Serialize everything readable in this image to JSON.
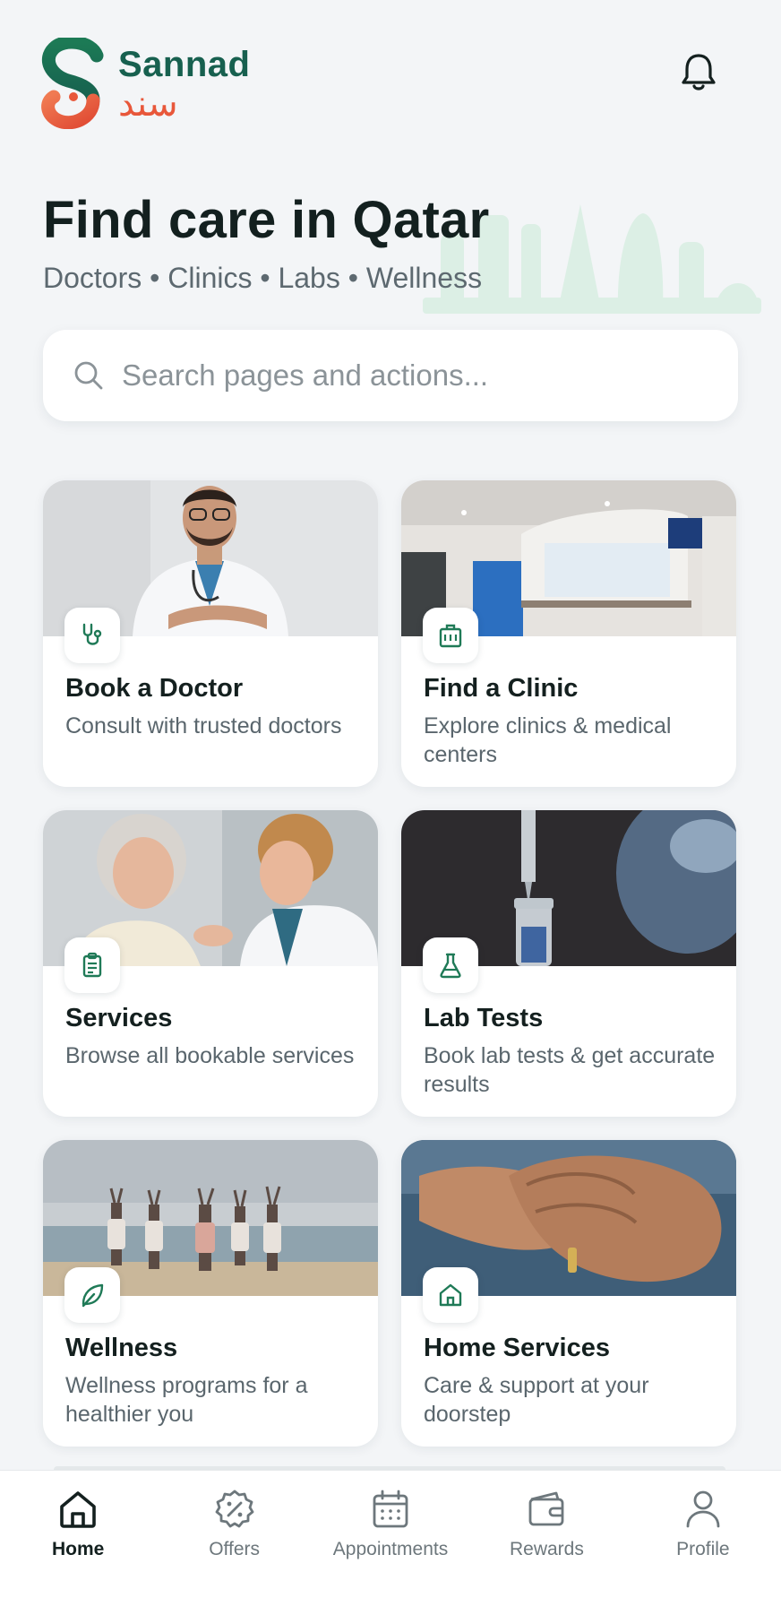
{
  "brand": {
    "name_en": "Sannad",
    "name_ar": "سند",
    "primary": "#17604f",
    "accent": "#e8573a"
  },
  "header": {
    "notification_icon": "bell-icon"
  },
  "hero": {
    "title": "Find care in Qatar",
    "subtitle": "Doctors • Clinics • Labs • Wellness"
  },
  "search": {
    "placeholder": "Search pages and actions...",
    "value": "",
    "icon": "search-icon"
  },
  "cards": [
    {
      "title": "Book a Doctor",
      "description": "Consult with trusted doctors",
      "icon": "stethoscope-icon"
    },
    {
      "title": "Find a Clinic",
      "description": "Explore clinics & medical centers",
      "icon": "building-icon"
    },
    {
      "title": "Services",
      "description": "Browse all bookable services",
      "icon": "clipboard-icon"
    },
    {
      "title": "Lab Tests",
      "description": "Book lab tests & get accurate results",
      "icon": "flask-icon"
    },
    {
      "title": "Wellness",
      "description": "Wellness programs for a healthier you",
      "icon": "leaf-icon"
    },
    {
      "title": "Home Services",
      "description": "Care & support at your doorstep",
      "icon": "house-icon"
    }
  ],
  "nav": {
    "active": "Home",
    "items": [
      {
        "label": "Home",
        "icon": "home-icon"
      },
      {
        "label": "Offers",
        "icon": "discount-badge-icon"
      },
      {
        "label": "Appointments",
        "icon": "calendar-icon"
      },
      {
        "label": "Rewards",
        "icon": "wallet-icon"
      },
      {
        "label": "Profile",
        "icon": "user-icon"
      }
    ]
  }
}
